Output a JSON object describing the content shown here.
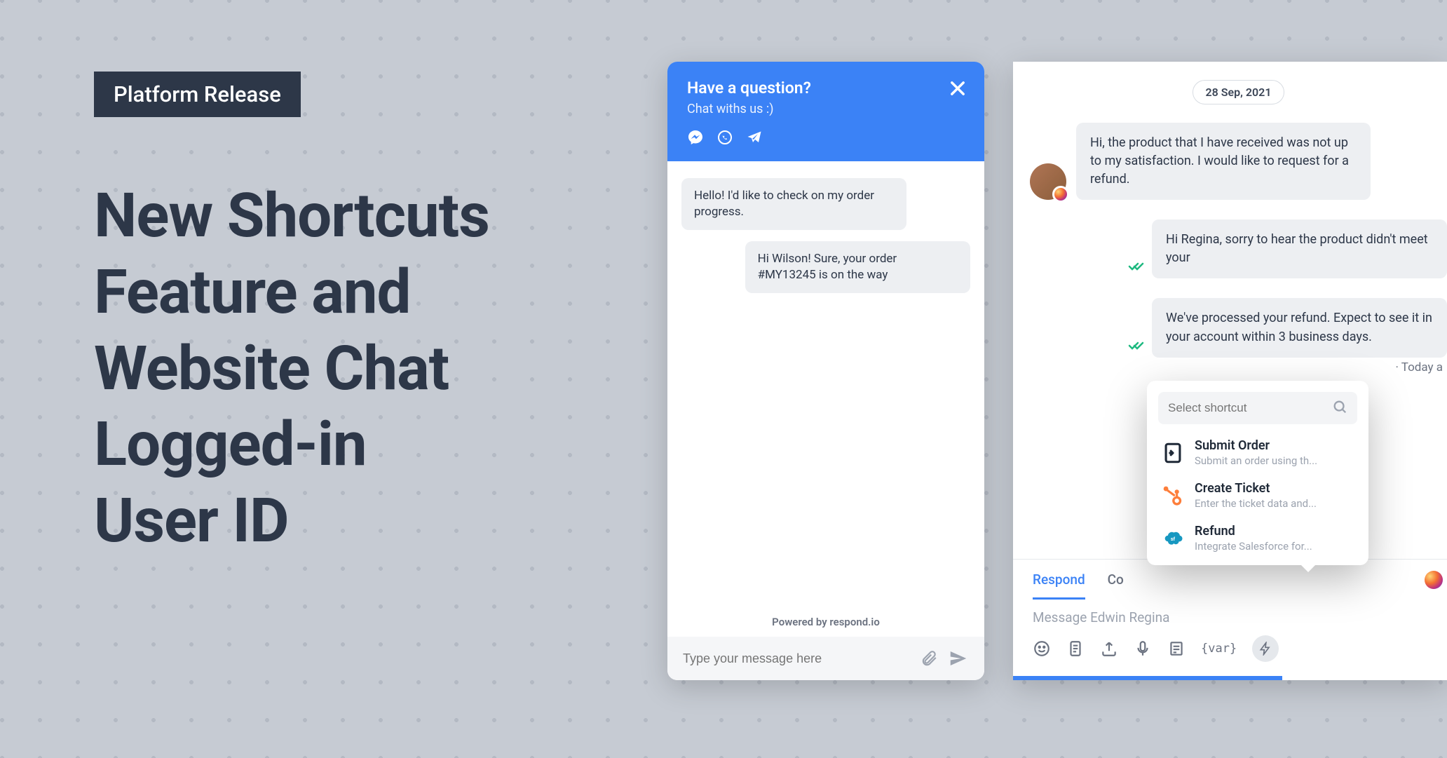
{
  "banner": {
    "label": "Platform Release",
    "title": "New Shortcuts Feature and Website Chat Logged-in User ID"
  },
  "chatWidget": {
    "headerTitle": "Have a question?",
    "headerSubtitle": "Chat withs us :)",
    "messages": [
      {
        "side": "left",
        "text": "Hello! I'd like to check on my order progress."
      },
      {
        "side": "right",
        "text": "Hi Wilson! Sure, your order #MY13245 is on the way"
      }
    ],
    "poweredBy": "Powered by respond.io",
    "inputPlaceholder": "Type your message here"
  },
  "conversation": {
    "datePill": "28 Sep, 2021",
    "incoming": "Hi, the product that I have received was not up to my satisfaction. I would like to request for a refund.",
    "outgoing1": "Hi Regina, sorry to hear the product didn't meet your",
    "outgoing2": "We've processed your refund. Expect to see it in your account within 3 business days.",
    "todayLabel": "· Today a",
    "tabs": {
      "respond": "Respond",
      "comment": "Co"
    },
    "composePlaceholder": "Message Edwin Regina",
    "varLabel": "{var}"
  },
  "shortcuts": {
    "searchPlaceholder": "Select shortcut",
    "items": [
      {
        "title": "Submit Order",
        "desc": "Submit an order using th..."
      },
      {
        "title": "Create Ticket",
        "desc": "Enter the ticket data and..."
      },
      {
        "title": "Refund",
        "desc": "Integrate Salesforce for..."
      }
    ]
  }
}
